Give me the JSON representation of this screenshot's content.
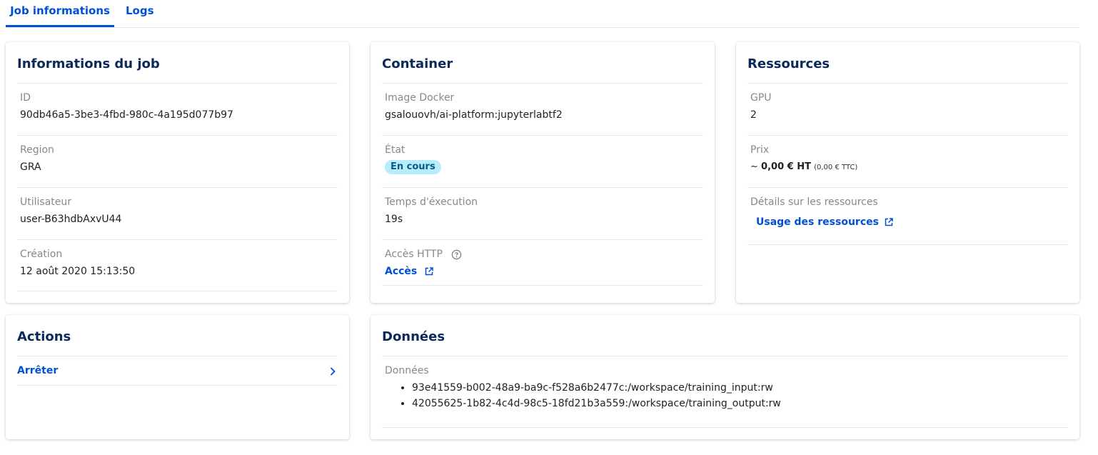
{
  "tabs": [
    {
      "label": "Job informations",
      "active": true
    },
    {
      "label": "Logs",
      "active": false
    }
  ],
  "job_info": {
    "title": "Informations du job",
    "fields": [
      {
        "label": "ID",
        "value": "90db46a5-3be3-4fbd-980c-4a195d077b97"
      },
      {
        "label": "Region",
        "value": "GRA"
      },
      {
        "label": "Utilisateur",
        "value": "user-B63hdbAxvU44"
      },
      {
        "label": "Création",
        "value": "12 août 2020 15:13:50"
      }
    ]
  },
  "container": {
    "title": "Container",
    "image_label": "Image Docker",
    "image_value": "gsalouovh/ai-platform:jupyterlabtf2",
    "state_label": "État",
    "state_value": "En cours",
    "exec_label": "Temps d'éxecution",
    "exec_value": "19s",
    "http_label": "Accès HTTP",
    "http_link": "Accès"
  },
  "resources": {
    "title": "Ressources",
    "gpu_label": "GPU",
    "gpu_value": "2",
    "price_label": "Prix",
    "price_prefix": "~",
    "price_ht": "0,00 € HT",
    "price_ttc": "(0,00 € TTC)",
    "details_label": "Détails sur les ressources",
    "details_link": "Usage des ressources"
  },
  "actions": {
    "title": "Actions",
    "items": [
      {
        "label": "Arrêter"
      }
    ]
  },
  "data_section": {
    "title": "Données",
    "label": "Données",
    "items": [
      "93e41559-b002-48a9-ba9c-f528a6b2477c:/workspace/training_input:rw",
      "42055625-1b82-4c4d-98c5-18fd21b3a559:/workspace/training_output:rw"
    ]
  },
  "colors": {
    "accent": "#0050d7",
    "heading": "#0b2a5a",
    "badge_bg": "#b7ecfb"
  }
}
